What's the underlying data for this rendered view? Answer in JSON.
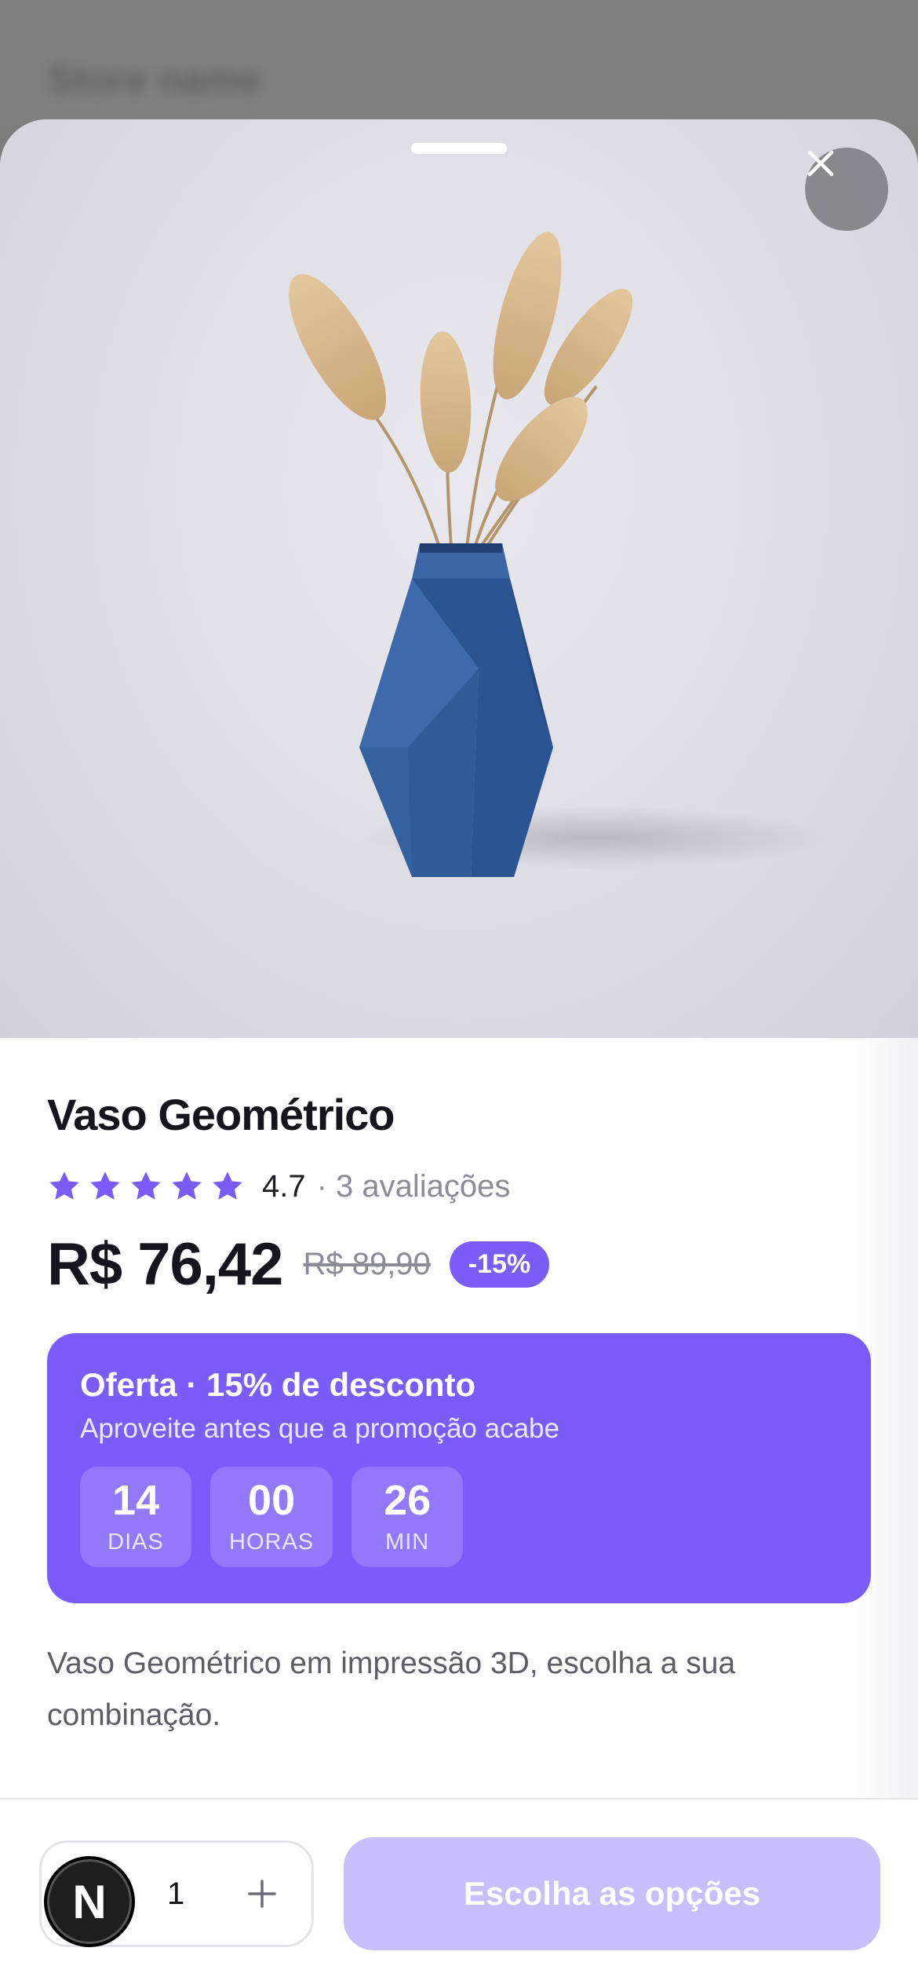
{
  "backdrop": {
    "title": "Store name"
  },
  "product": {
    "title": "Vaso Geométrico",
    "rating": {
      "stars": 5,
      "value": "4.7",
      "count_label": "· 3 avaliações"
    },
    "price": "R$ 76,42",
    "old_price": "R$ 89,90",
    "discount": "-15%",
    "description": "Vaso Geométrico em impressão 3D, escolha a sua combinação."
  },
  "offer": {
    "title": "Oferta · 15% de desconto",
    "subtitle": "Aproveite antes que a promoção acabe",
    "timer": [
      {
        "value": "14",
        "label": "DIAS"
      },
      {
        "value": "00",
        "label": "HORAS"
      },
      {
        "value": "26",
        "label": "MIN"
      }
    ]
  },
  "bottom_bar": {
    "quantity": "1",
    "avatar_letter": "N",
    "cta_label": "Escolha as opções"
  },
  "colors": {
    "accent": "#7a5cfb",
    "cta_disabled": "#c8befc",
    "vase": "#2f5c9a"
  },
  "icons": {
    "close": "close-icon",
    "star": "star-icon",
    "plus": "plus-icon"
  }
}
